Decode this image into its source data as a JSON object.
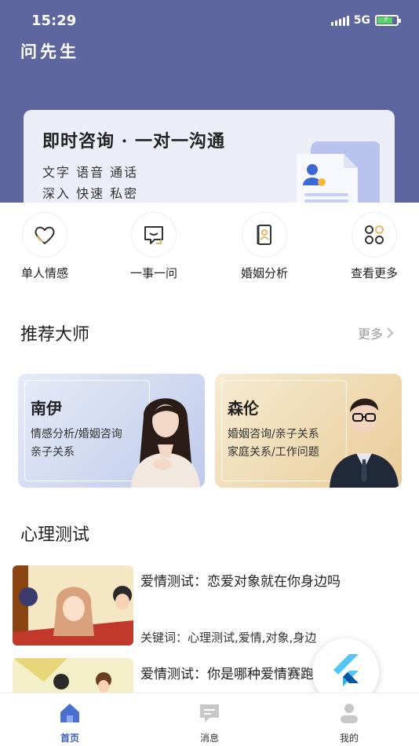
{
  "status_bar": {
    "time": "15:29",
    "network": "5G"
  },
  "header": {
    "app_title": "问先生"
  },
  "banner": {
    "title": "即时咨询 · 一对一沟通",
    "line1": "文字 语音 通话",
    "line2": "深入 快速 私密"
  },
  "quick_actions": [
    {
      "label": "单人情感",
      "icon": "heart-icon"
    },
    {
      "label": "一事一问",
      "icon": "chat-bubble-icon"
    },
    {
      "label": "婚姻分析",
      "icon": "profile-card-icon"
    },
    {
      "label": "查看更多",
      "icon": "grid-icon"
    }
  ],
  "recommended": {
    "title": "推荐大师",
    "more_label": "更多",
    "masters": [
      {
        "name": "南伊",
        "tag1": "情感分析/婚姻咨询",
        "tag2": "亲子关系"
      },
      {
        "name": "森伦",
        "tag1": "婚姻咨询/亲子关系",
        "tag2": "家庭关系/工作问题"
      }
    ]
  },
  "psych_test": {
    "title": "心理测试",
    "items": [
      {
        "title": "爱情测试：恋爱对象就在你身边吗",
        "keywords": "关键词：心理测试,爱情,对象,身边"
      },
      {
        "title": "爱情测试：你是哪种爱情赛跑"
      }
    ]
  },
  "tabbar": [
    {
      "label": "首页",
      "icon": "home-icon"
    },
    {
      "label": "消息",
      "icon": "message-icon"
    },
    {
      "label": "我的",
      "icon": "profile-icon"
    }
  ],
  "colors": {
    "header": "#5e66a0",
    "accent": "#3b5fbf",
    "banner_bg": "#eceef7"
  }
}
